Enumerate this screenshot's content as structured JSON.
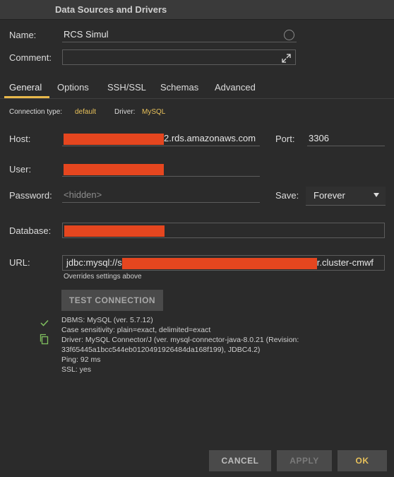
{
  "window": {
    "title": "Data Sources and Drivers"
  },
  "form": {
    "name_label": "Name:",
    "name_value": "RCS Simul",
    "comment_label": "Comment:",
    "comment_value": ""
  },
  "tabs": [
    {
      "label": "General",
      "active": true
    },
    {
      "label": "Options",
      "active": false
    },
    {
      "label": "SSH/SSL",
      "active": false
    },
    {
      "label": "Schemas",
      "active": false
    },
    {
      "label": "Advanced",
      "active": false
    }
  ],
  "connection": {
    "type_label": "Connection type:",
    "type_value": "default",
    "driver_label": "Driver:",
    "driver_value": "MySQL",
    "host_label": "Host:",
    "host_suffix": "2.rds.amazonaws.com",
    "port_label": "Port:",
    "port_value": "3306",
    "user_label": "User:",
    "password_label": "Password:",
    "password_placeholder": "<hidden>",
    "save_label": "Save:",
    "save_value": "Forever",
    "database_label": "Database:",
    "url_label": "URL:",
    "url_prefix": "jdbc:mysql://s",
    "url_suffix": "r.cluster-cmwf",
    "url_note": "Overrides settings above"
  },
  "test": {
    "button_label": "TEST CONNECTION",
    "info_lines": [
      "DBMS: MySQL (ver. 5.7.12)",
      "Case sensitivity: plain=exact, delimited=exact",
      "Driver: MySQL Connector/J (ver. mysql-connector-java-8.0.21 (Revision:",
      "33f65445a1bcc544eb0120491926484da168f199), JDBC4.2)",
      "Ping: 92 ms",
      "SSL: yes"
    ]
  },
  "footer": {
    "cancel_label": "CANCEL",
    "apply_label": "APPLY",
    "ok_label": "OK"
  },
  "colors": {
    "accent": "#e8c15a",
    "redaction": "#e5461f",
    "background": "#2b2b2b"
  },
  "icons": [
    "color-circle-icon",
    "expand-icon",
    "dropdown-arrow-icon",
    "check-icon",
    "copy-icon"
  ]
}
